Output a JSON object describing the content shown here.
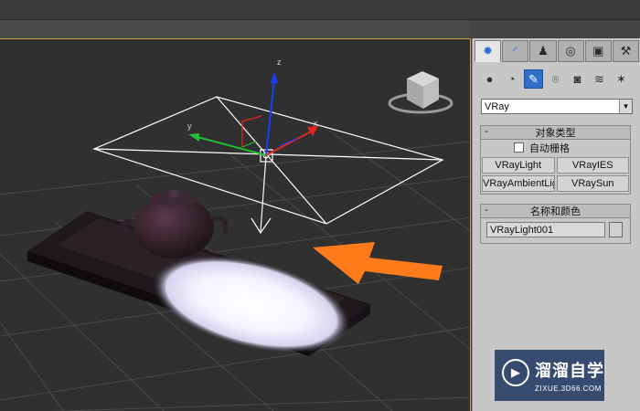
{
  "command_panel": {
    "tabs": [
      {
        "name": "create-tab",
        "glyph": "✹"
      },
      {
        "name": "modify-tab",
        "glyph": "◜"
      },
      {
        "name": "hierarchy-tab",
        "glyph": "♟"
      },
      {
        "name": "motion-tab",
        "glyph": "◎"
      },
      {
        "name": "display-tab",
        "glyph": "▣"
      },
      {
        "name": "utilities-tab",
        "glyph": "⚒"
      }
    ],
    "category_icons": [
      {
        "name": "geometry-icon",
        "glyph": "●"
      },
      {
        "name": "shapes-icon",
        "glyph": "◔"
      },
      {
        "name": "lights-icon",
        "glyph": "✎"
      },
      {
        "name": "cameras-icon",
        "glyph": "⌾"
      },
      {
        "name": "helpers-icon",
        "glyph": "◙"
      },
      {
        "name": "space-warps-icon",
        "glyph": "≋"
      },
      {
        "name": "systems-icon",
        "glyph": "✶"
      }
    ],
    "renderer_dropdown": {
      "value": "VRay",
      "arrow": "▼"
    },
    "object_type": {
      "toggle": "-",
      "title": "对象类型",
      "autogrid_label": "自动栅格",
      "buttons": [
        "VRayLight",
        "VRayIES",
        "VRayAmbientLight",
        "VRaySun"
      ]
    },
    "name_and_color": {
      "toggle": "-",
      "title": "名称和颜色",
      "name_value": "VRayLight001"
    }
  },
  "viewport": {
    "axis_labels": {
      "x": "x",
      "y": "y",
      "z": "z"
    }
  },
  "watermark": {
    "logo_glyph": "▶",
    "title": "溜溜自学",
    "subtitle": "ZIXUE.3D66.COM"
  }
}
